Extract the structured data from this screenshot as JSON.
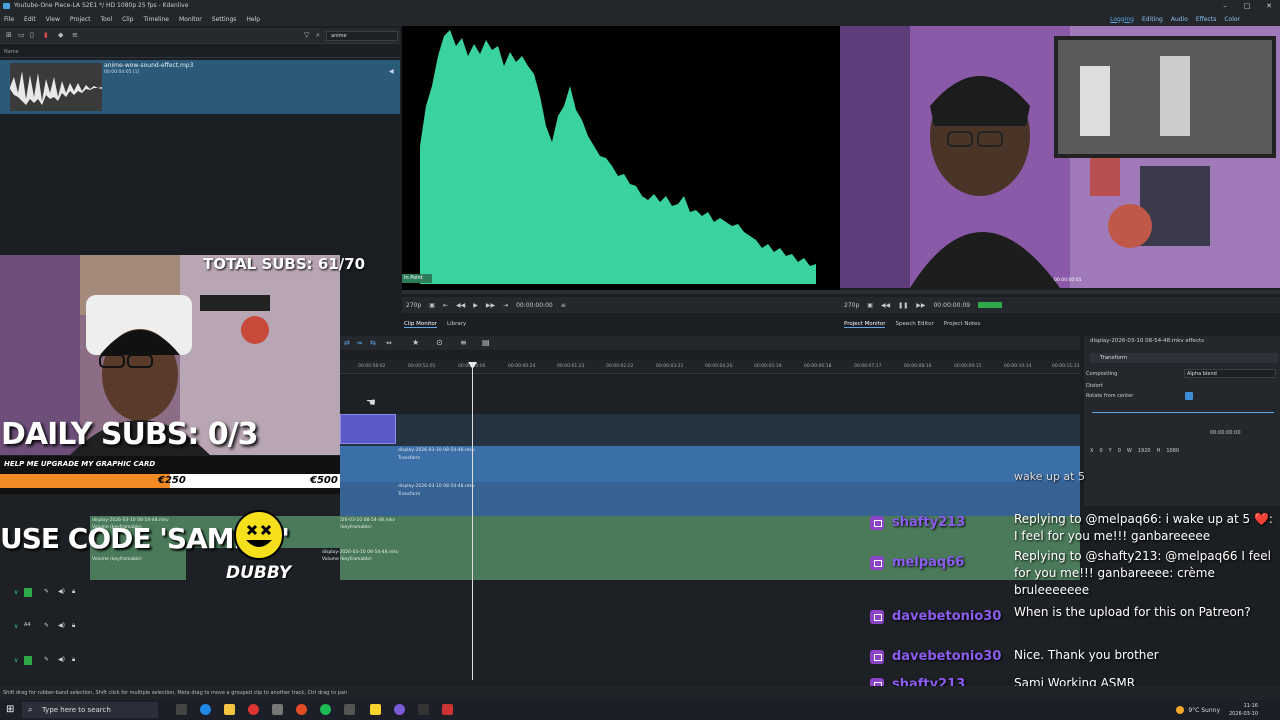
{
  "window": {
    "title": "Youtube-One Piece-LA S2E1 */ HD 1080p 25 fps - Kdenlive"
  },
  "menu": [
    "File",
    "Edit",
    "View",
    "Project",
    "Tool",
    "Clip",
    "Timeline",
    "Monitor",
    "Settings",
    "Help"
  ],
  "layouts": [
    "Logging",
    "Editing",
    "Audio",
    "Effects",
    "Color"
  ],
  "bin": {
    "search_value": "anime",
    "column": "Name",
    "clip_name": "anime-wow-sound-effect.mp3",
    "clip_duration": "00:00:04:05 [1]"
  },
  "clip_monitor": {
    "badge": "In Point",
    "zoom": "270p",
    "timecode": "00:00:00:00",
    "tabs": [
      "Clip Monitor",
      "Library"
    ]
  },
  "project_monitor": {
    "zoom": "270p",
    "timecode": "00:00:00:09",
    "tabs": [
      "Project Monitor",
      "Speech Editor",
      "Project Notes"
    ],
    "small_tc": "00:00:00:01"
  },
  "overlay": {
    "total_subs": "TOTAL SUBS: 61/70",
    "daily_subs": "DAILY SUBS: 0/3",
    "goal_title": "HELP ME UPGRADE MY GRAPHIC CARD",
    "goal_current": "€250",
    "goal_max": "€500",
    "goal_progress": 0.5,
    "use_code": "USE CODE 'SAMISY'",
    "dubby": "DUBBY"
  },
  "timeline": {
    "ruler": [
      "00:00:58:02",
      "00:00:52:01",
      "00:00:00:00",
      "00:00:00:24",
      "00:00:01:23",
      "00:00:02:22",
      "00:00:03:21",
      "00:00:04:20",
      "00:00:05:19",
      "00:00:06:18",
      "00:00:07:17",
      "00:00:08:16",
      "00:00:09:15",
      "00:00:10:14",
      "00:00:11:13"
    ],
    "clips": {
      "v1": "display-2026-03-10 08-54-48.mkv",
      "transform": "Transform",
      "volume": "Volume (keyframable)",
      "a1": "sonry-2026-03-10 08-54-48.mkv"
    },
    "tracks": [
      "A1",
      "A2",
      "A3",
      "A4"
    ]
  },
  "properties": {
    "header": "display-2026-03-10 08-54-48.mkv effects",
    "effect": "Transform",
    "compositing_label": "Compositing",
    "compositing_value": "Alpha blend",
    "distort": "Distort",
    "rotate": "Rotate from center",
    "timecode": "00:00:00:00",
    "x": "0",
    "y": "0",
    "w": "1920",
    "h": "1080"
  },
  "chat": [
    {
      "user": "shafty213",
      "user_color": "#9146ff",
      "text": "Replying to @melpaq66: i wake up at 5 ❤️: I feel for you me!!! ganbareeeee"
    },
    {
      "user": "melpaq66",
      "user_color": "#9146ff",
      "text": "Replying to @shafty213: @melpaq66 I feel for you me!!! ganbareeee: crème bruleeeeeee"
    },
    {
      "user": "davebetonio30",
      "user_color": "#9146ff",
      "text": "When is the upload for this on Patreon?"
    },
    {
      "user": "davebetonio30",
      "user_color": "#9146ff",
      "text": "Nice. Thank you brother"
    },
    {
      "user": "shafty213",
      "user_color": "#9146ff",
      "text": "Sami Working ASMR"
    }
  ],
  "chat_prev": "wake up at 5",
  "statusbar": "Shift drag for rubber-band selection, Shift click for multiple selection, Meta drag to move a grouped clip to another track, Ctrl drag to pan",
  "taskbar": {
    "search": "Type here to search",
    "weather": "9°C Sunny",
    "time": "11:16",
    "date": "2026-03-10"
  },
  "colors": {
    "accent": "#5fa8e8",
    "waveform": "#3ad29f",
    "clip_video": "#3b6fa8",
    "clip_audio": "#4b7a5a",
    "twitch": "#9146ff",
    "goal_fill": "#f08a24"
  }
}
